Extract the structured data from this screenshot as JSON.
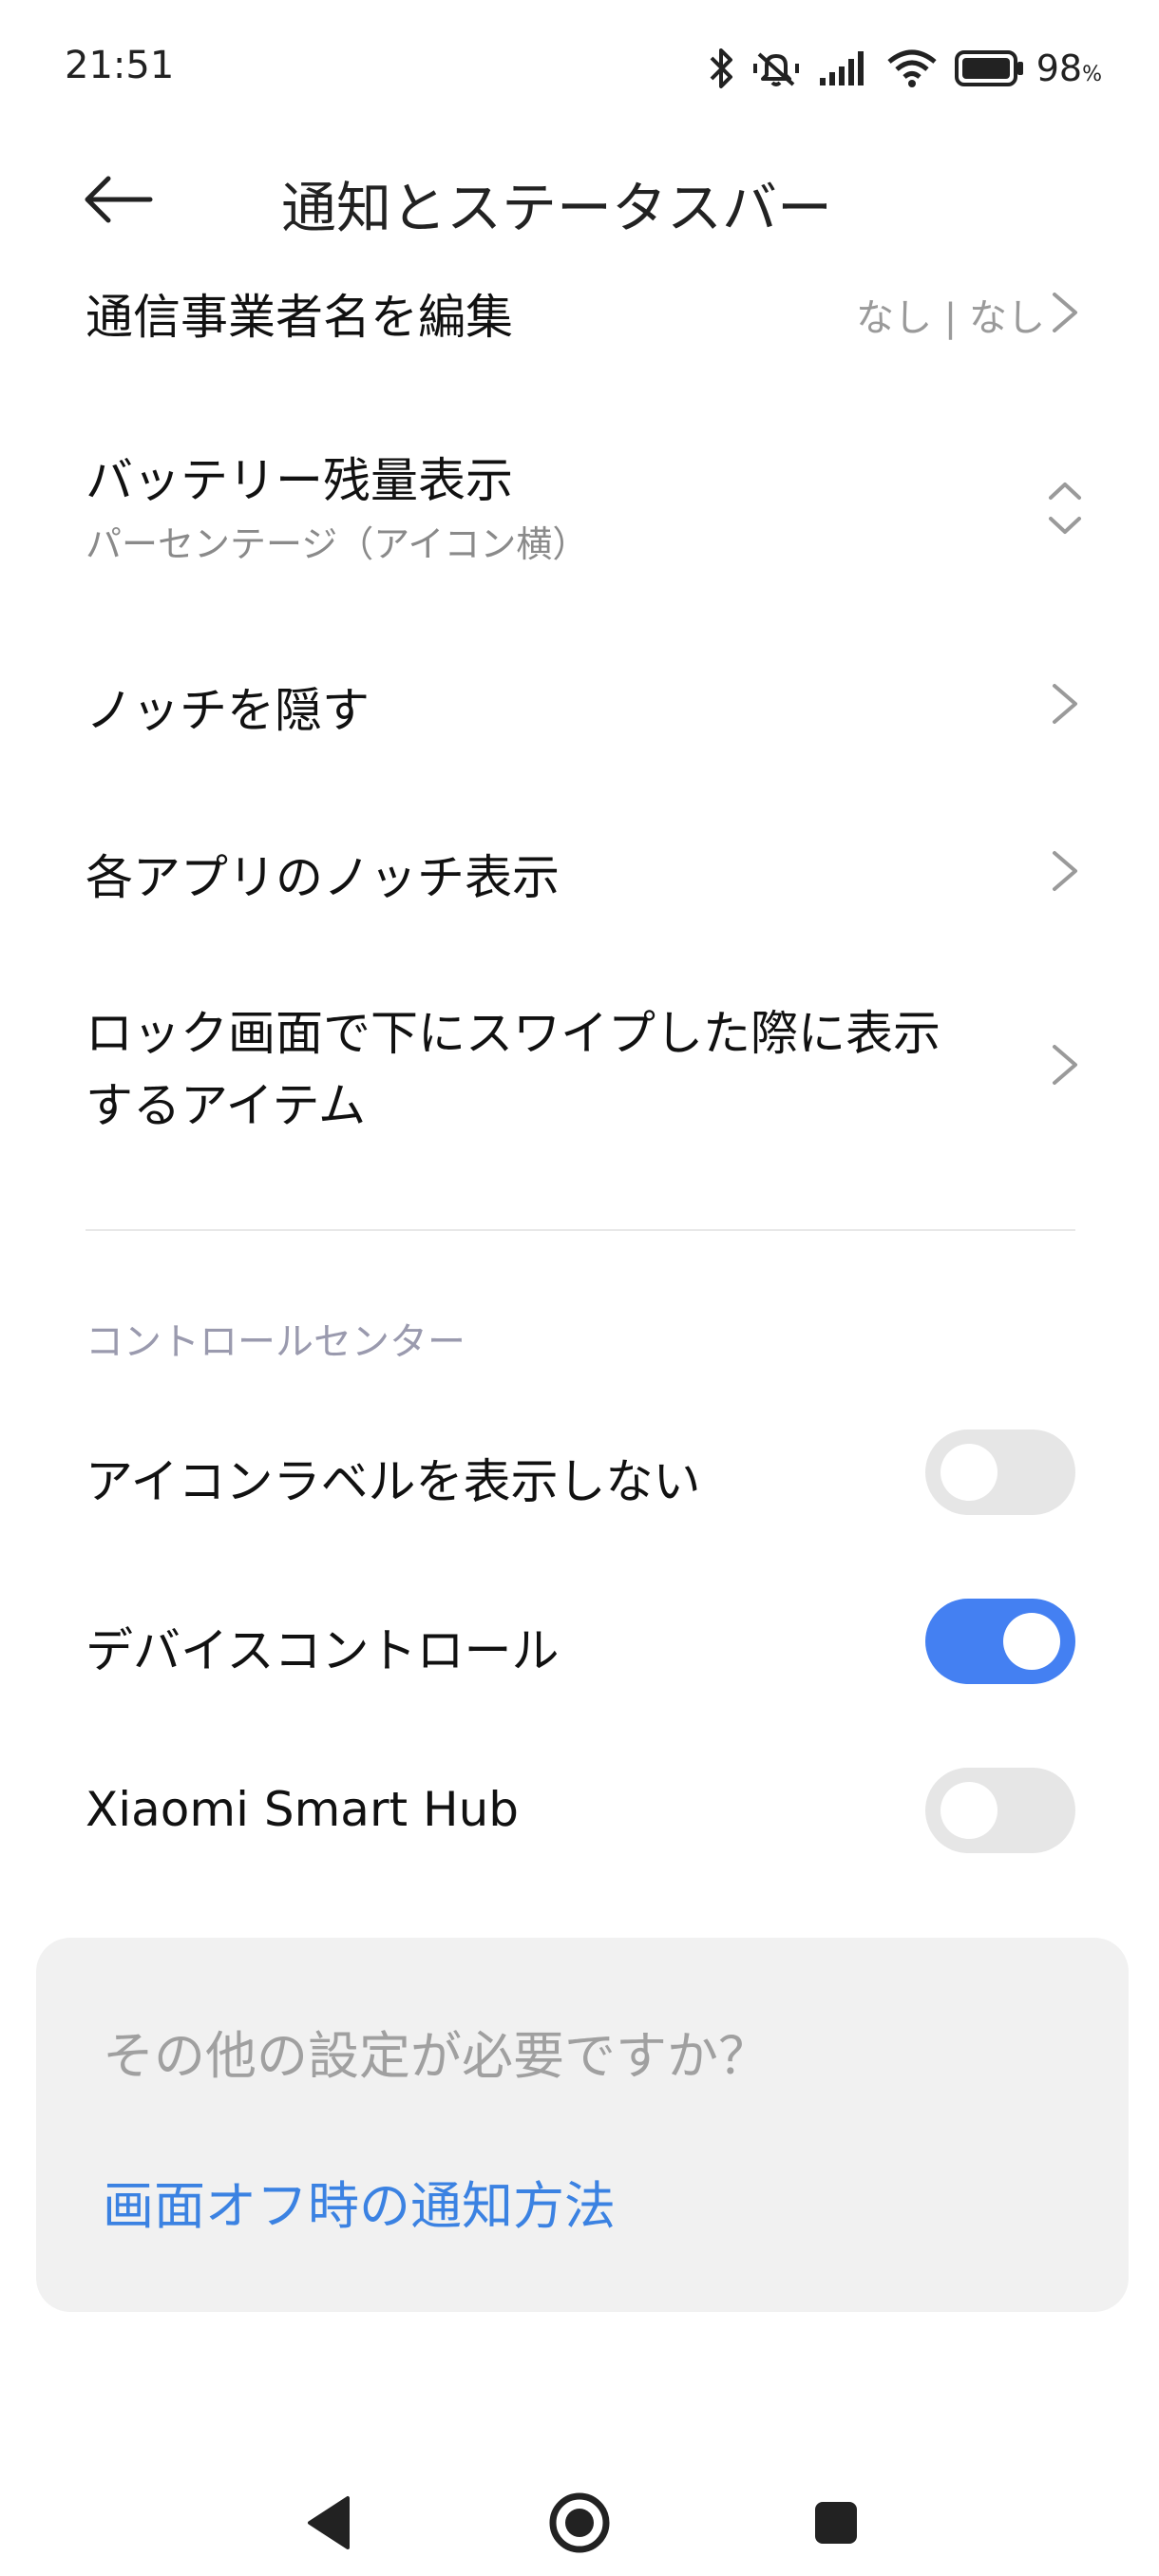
{
  "status_bar": {
    "time": "21:51",
    "battery_percent": "98",
    "battery_unit": "%",
    "icons": [
      "bluetooth-icon",
      "vibrate-off-icon",
      "signal-icon",
      "wifi-icon",
      "battery-icon"
    ]
  },
  "header": {
    "title": "通知とステータスバー",
    "back_icon": "arrow-left-icon"
  },
  "rows": {
    "carrier": {
      "title": "通信事業者名を編集",
      "value": "なし | なし"
    },
    "battery": {
      "title": "バッテリー残量表示",
      "subtitle": "パーセンテージ（アイコン横）"
    },
    "notch_hide": {
      "title": "ノッチを隠す"
    },
    "app_notch": {
      "title": "各アプリのノッチ表示"
    },
    "lock_swipe": {
      "title_line1": "ロック画面で下にスワイプした際に表示",
      "title_line2": "するアイテム"
    }
  },
  "control_center": {
    "section_title": "コントロールセンター",
    "items": [
      {
        "title": "アイコンラベルを表示しない",
        "enabled": false
      },
      {
        "title": "デバイスコントロール",
        "enabled": true
      },
      {
        "title": "Xiaomi Smart Hub",
        "enabled": false
      }
    ]
  },
  "suggestion": {
    "question": "その他の設定が必要ですか？",
    "link": "画面オフ時の通知方法"
  },
  "colors": {
    "accent": "#4480f2",
    "link": "#3b82e2",
    "toggle_off": "#e6e6e6",
    "card_bg": "#f1f1f1"
  },
  "navbar": {
    "icons": [
      "back-triangle-icon",
      "home-circle-icon",
      "recents-square-icon"
    ]
  }
}
